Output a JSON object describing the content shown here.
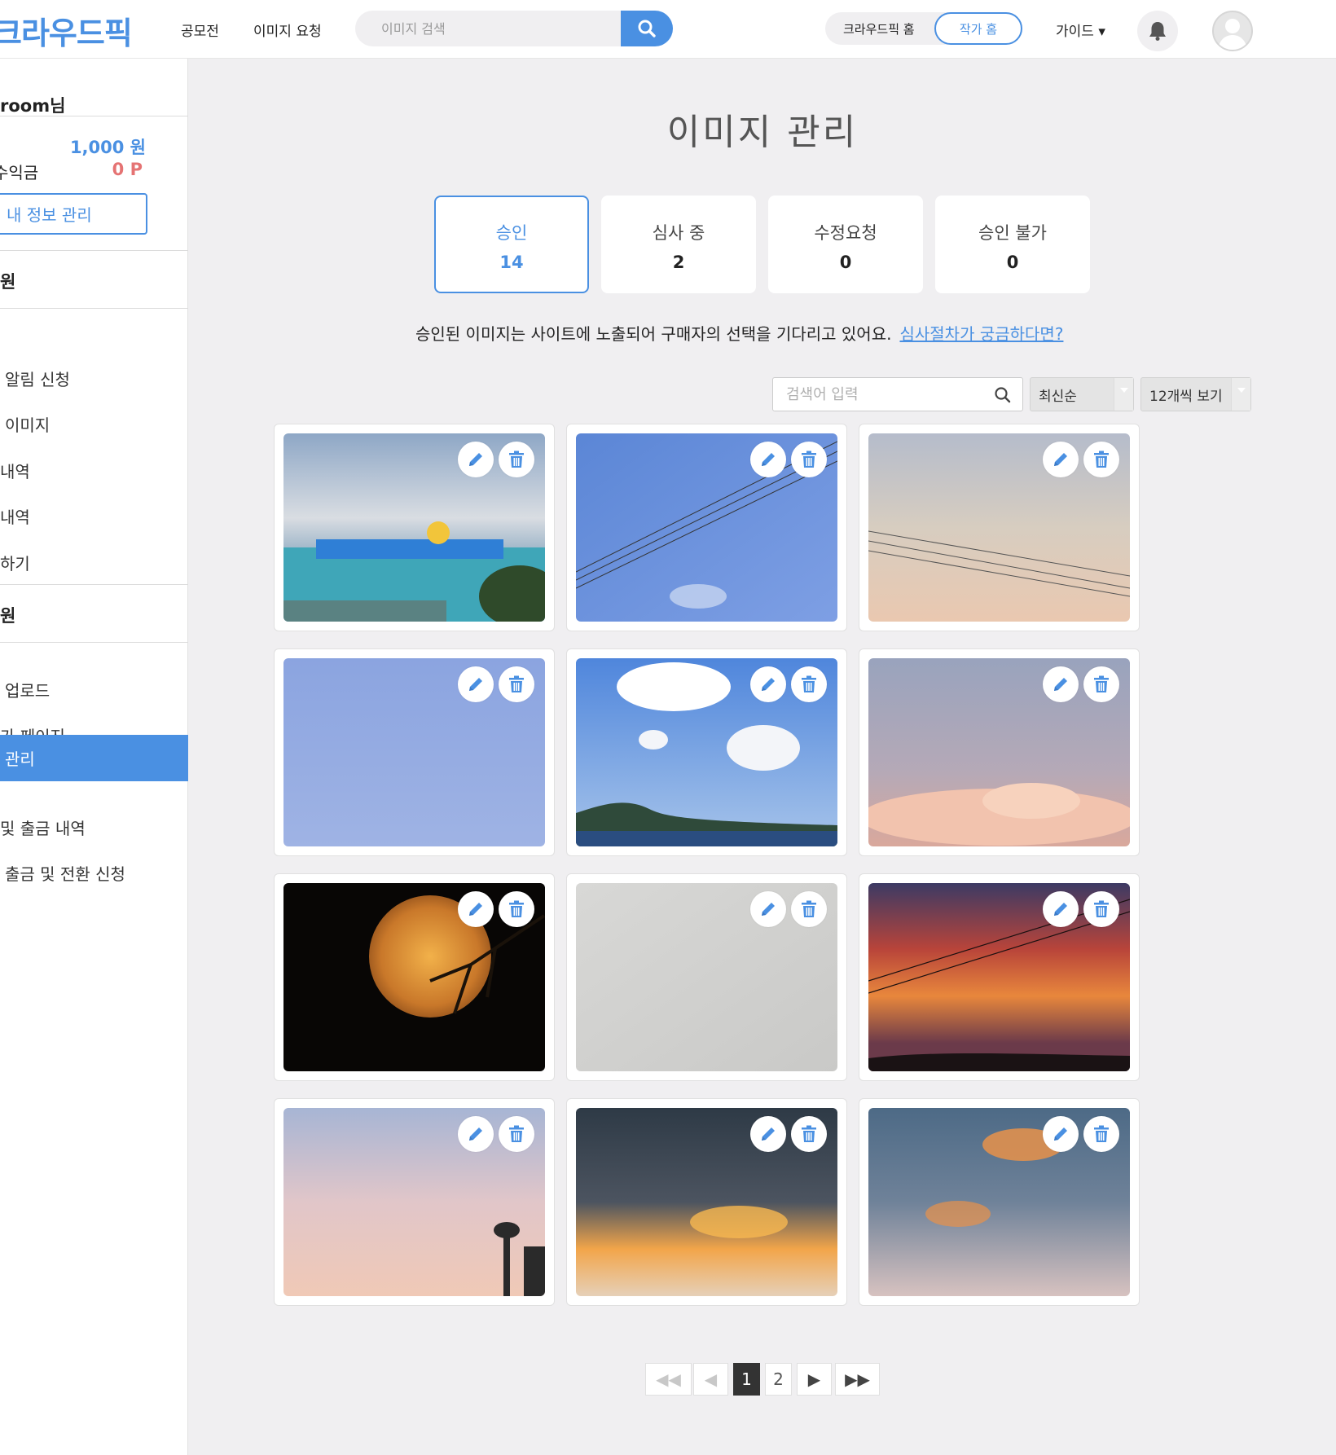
{
  "header": {
    "logo": "크라우드픽",
    "nav": [
      "공모전",
      "이미지 요청"
    ],
    "search_placeholder": "이미지 검색",
    "home_label": "크라우드픽 홈",
    "author_home_label": "작가 홈",
    "guide_label": "가이드 ▾"
  },
  "sidebar": {
    "user_name": "room님",
    "balance_value": "1,000 원",
    "earnings_label": "수익금",
    "earnings_value": "0 P",
    "manage_button": "내 정보 관리",
    "section1_title": "원",
    "section1_items": [
      "알림 신청",
      "이미지",
      "내역",
      "내역",
      "하기"
    ],
    "section2_title": "원",
    "section2_items": [
      "업로드",
      "가 페이지",
      "관리",
      "및 출금 내역",
      "출금 및 전환 신청"
    ],
    "active_item": "관리"
  },
  "main": {
    "title": "이미지 관리",
    "tabs": [
      {
        "label": "승인",
        "count": "14"
      },
      {
        "label": "심사 중",
        "count": "2"
      },
      {
        "label": "수정요청",
        "count": "0"
      },
      {
        "label": "승인 불가",
        "count": "0"
      }
    ],
    "description": "승인된 이미지는 사이트에 노출되어 구매자의 선택을 기다리고 있어요.",
    "description_link": "심사절차가 궁금하다면?",
    "filter_placeholder": "검색어 입력",
    "sort_label": "최신순",
    "per_page_label": "12개씩 보기",
    "images": [
      {
        "name": "water-park-photo"
      },
      {
        "name": "blue-sky-wires-photo"
      },
      {
        "name": "hazy-sky-wires-photo"
      },
      {
        "name": "clear-blue-sky-photo"
      },
      {
        "name": "clouds-island-photo"
      },
      {
        "name": "pink-clouds-photo"
      },
      {
        "name": "moon-tree-photo"
      },
      {
        "name": "sand-texture-photo"
      },
      {
        "name": "red-sunset-photo"
      },
      {
        "name": "pastel-sky-palms-photo"
      },
      {
        "name": "dark-sunset-clouds-photo"
      },
      {
        "name": "orange-clouds-photo"
      }
    ],
    "pagination": {
      "first": "◀◀",
      "prev": "◀",
      "pages": [
        "1",
        "2"
      ],
      "current": "1",
      "next": "▶",
      "last": "▶▶"
    }
  },
  "colors": {
    "accent": "#4a90e2",
    "points": "#e57373",
    "background": "#f0eff1"
  }
}
